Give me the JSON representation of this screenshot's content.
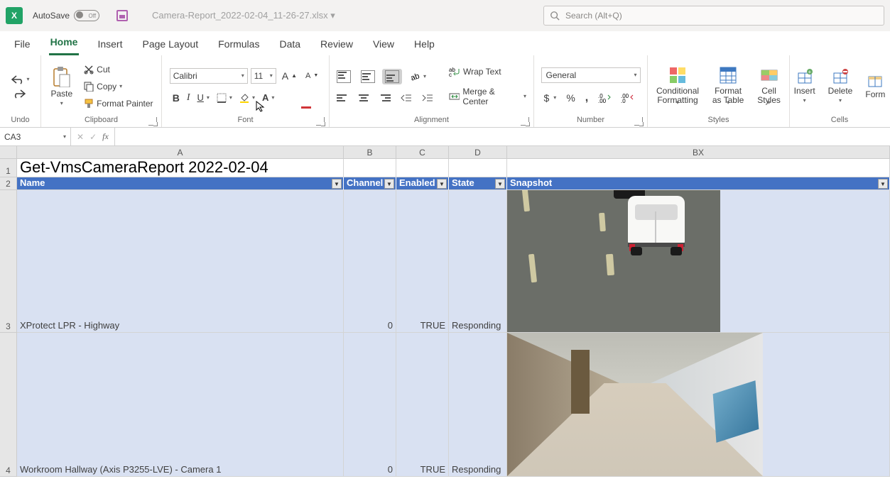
{
  "titlebar": {
    "autosave_label": "AutoSave",
    "autosave_state": "Off",
    "filename": "Camera-Report_2022-02-04_11-26-27.xlsx ▾",
    "search_placeholder": "Search (Alt+Q)"
  },
  "tabs": {
    "file": "File",
    "home": "Home",
    "insert": "Insert",
    "page_layout": "Page Layout",
    "formulas": "Formulas",
    "data": "Data",
    "review": "Review",
    "view": "View",
    "help": "Help"
  },
  "ribbon": {
    "undo_label": "Undo",
    "clipboard": {
      "paste": "Paste",
      "cut": "Cut",
      "copy": "Copy",
      "format_painter": "Format Painter",
      "label": "Clipboard"
    },
    "font": {
      "name": "Calibri",
      "size": "11",
      "label": "Font"
    },
    "alignment": {
      "wrap": "Wrap Text",
      "merge": "Merge & Center",
      "label": "Alignment"
    },
    "number": {
      "format": "General",
      "label": "Number"
    },
    "styles": {
      "cond": "Conditional Formatting",
      "table": "Format as Table",
      "cell": "Cell Styles",
      "label": "Styles"
    },
    "cells": {
      "insert": "Insert",
      "delete": "Delete",
      "format": "Form",
      "label": "Cells"
    }
  },
  "formula_bar": {
    "cell_ref": "CA3",
    "fx_label": "fx",
    "formula_value": ""
  },
  "grid": {
    "col_headers": {
      "A": "A",
      "B": "B",
      "C": "C",
      "D": "D",
      "BX": "BX"
    },
    "row_headers": {
      "1": "1",
      "2": "2",
      "3": "3",
      "4": "4"
    },
    "title": "Get-VmsCameraReport 2022-02-04",
    "headers": {
      "name": "Name",
      "channel": "Channel",
      "enabled": "Enabled",
      "state": "State",
      "snapshot": "Snapshot"
    },
    "rows": [
      {
        "name": "XProtect LPR - Highway",
        "channel": "0",
        "enabled": "TRUE",
        "state": "Responding"
      },
      {
        "name": "Workroom Hallway (Axis P3255-LVE) - Camera 1",
        "channel": "0",
        "enabled": "TRUE",
        "state": "Responding"
      }
    ]
  }
}
